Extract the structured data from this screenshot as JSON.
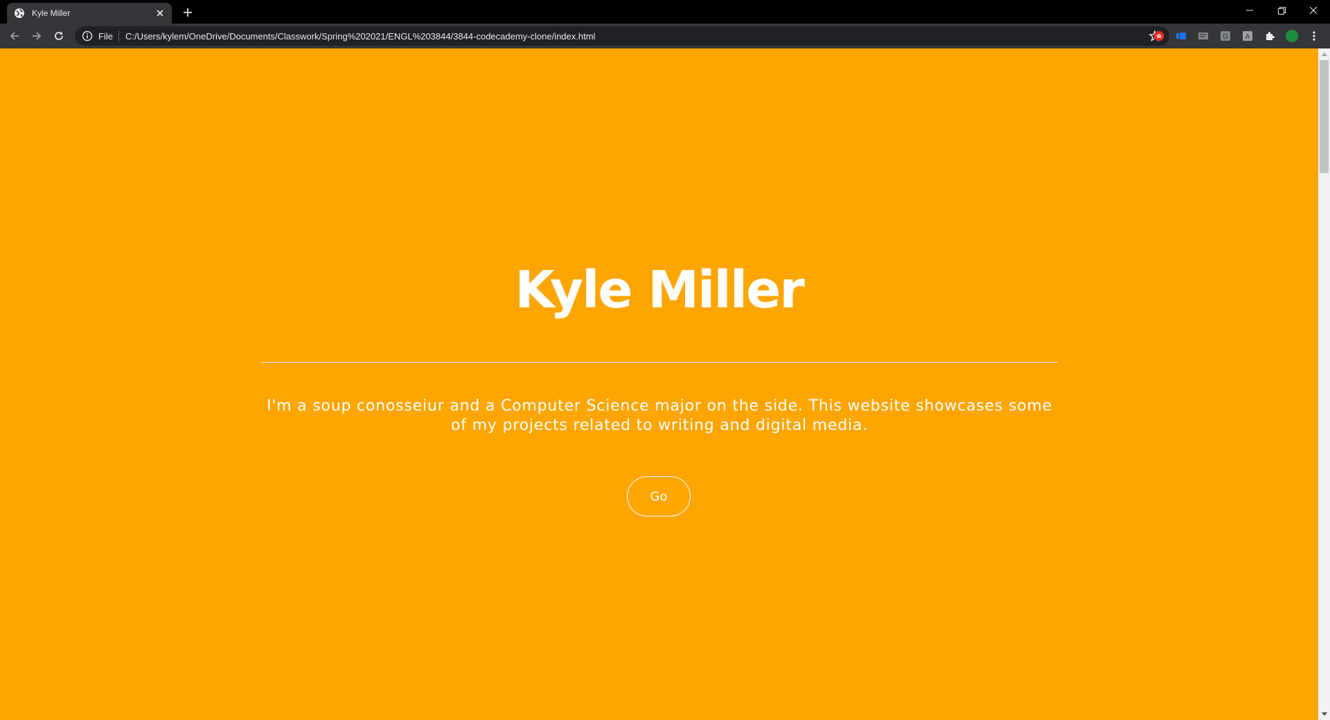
{
  "browser": {
    "tab": {
      "title": "Kyle Miller",
      "favicon": "globe-icon",
      "close_icon": "close-icon"
    },
    "new_tab_icon": "plus-icon",
    "window_controls": [
      "minimize-icon",
      "restore-icon",
      "close-icon"
    ],
    "toolbar": {
      "nav_icons": [
        "back-arrow-icon",
        "forward-arrow-icon",
        "reload-icon"
      ],
      "omnibox": {
        "security_chip": "File",
        "url": "C:/Users/kylem/OneDrive/Documents/Classwork/Spring%202021/ENGL%203844/3844-codecademy-clone/index.html"
      },
      "extension_icons": [
        "adblock-icon",
        "extension-blue-icon",
        "extension-grey-icon",
        "grammarly-icon",
        "extension-k-icon",
        "puzzle-icon",
        "profile-avatar-icon",
        "kebab-menu-icon"
      ]
    }
  },
  "page": {
    "title": "Kyle Miller",
    "intro": "I'm a soup conosseiur and a Computer Science major on the side. This website showcases some of my projects related to writing and digital media.",
    "cta_label": "Go",
    "colors": {
      "background": "#ffa500",
      "text": "#ffffff"
    }
  }
}
